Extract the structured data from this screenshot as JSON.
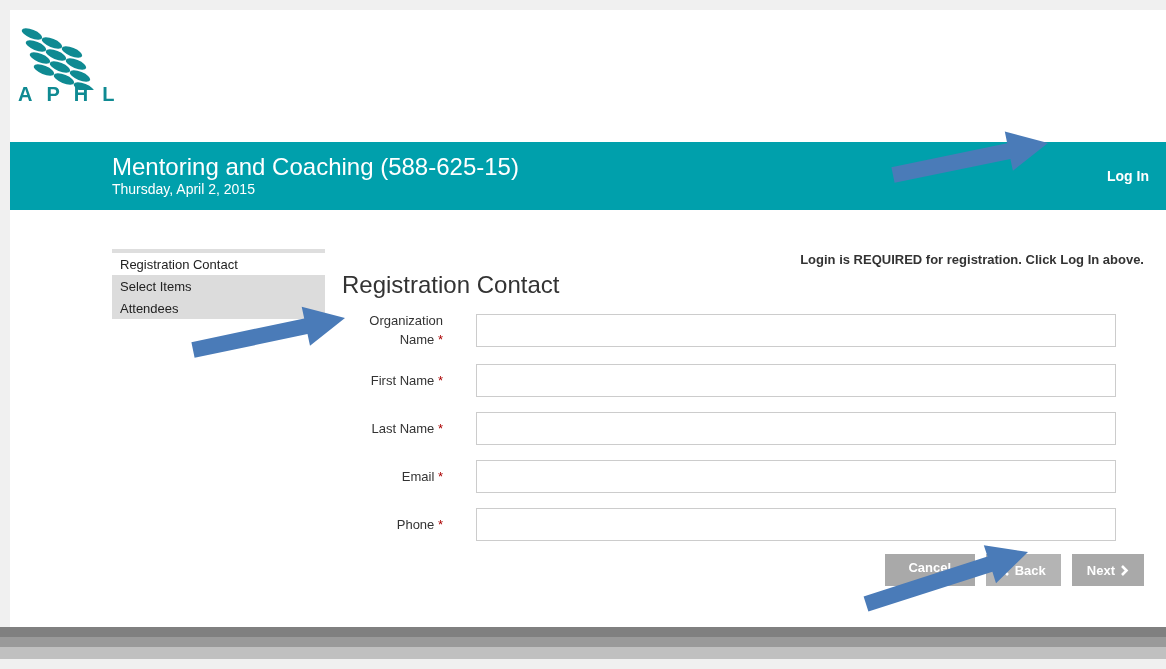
{
  "logo": {
    "text": "APHL"
  },
  "banner": {
    "title": "Mentoring and Coaching (588-625-15)",
    "date": "Thursday, April 2, 2015",
    "login_link": "Log In"
  },
  "sidebar": {
    "items": [
      {
        "label": "Registration Contact",
        "selected": true
      },
      {
        "label": "Select Items",
        "selected": false
      },
      {
        "label": "Attendees",
        "selected": false
      }
    ]
  },
  "notice": "Login is REQUIRED for registration. Click Log In above.",
  "form": {
    "title": "Registration Contact",
    "fields": [
      {
        "label": "Organization Name",
        "required_mark": "*"
      },
      {
        "label": "First Name",
        "required_mark": "*"
      },
      {
        "label": "Last Name",
        "required_mark": "*"
      },
      {
        "label": "Email",
        "required_mark": "*"
      },
      {
        "label": "Phone",
        "required_mark": "*"
      }
    ]
  },
  "buttons": [
    {
      "label": "Cancel",
      "kind": "cancel",
      "disabled": true
    },
    {
      "label": "Back",
      "kind": "back",
      "disabled": true
    },
    {
      "label": "Next",
      "kind": "next",
      "disabled": true
    }
  ]
}
